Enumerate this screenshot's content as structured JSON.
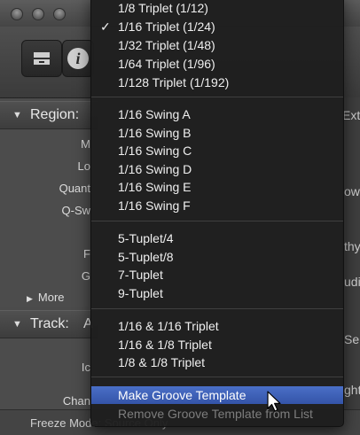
{
  "background": {
    "region_header": "Region:",
    "region_rows": [
      "M",
      "Lo",
      "Quant",
      "Q-Sw",
      "",
      "F",
      "G"
    ],
    "more_label": "More",
    "track_header": "Track:",
    "track_header_suffix": "A",
    "track_rows": [
      "Ic",
      "",
      "Chan"
    ],
    "bottom_text": "Freeze Mode:  Source Only",
    "right_fragments": [
      "Ext",
      "ow",
      "thy",
      "udi",
      "Sele",
      "ght"
    ]
  },
  "menu": {
    "groups": [
      {
        "items": [
          {
            "label": "1/8 Triplet (1/12)",
            "checked": false
          },
          {
            "label": "1/16 Triplet (1/24)",
            "checked": true
          },
          {
            "label": "1/32 Triplet (1/48)",
            "checked": false
          },
          {
            "label": "1/64 Triplet (1/96)",
            "checked": false
          },
          {
            "label": "1/128 Triplet (1/192)",
            "checked": false
          }
        ]
      },
      {
        "items": [
          {
            "label": "1/16 Swing A"
          },
          {
            "label": "1/16 Swing B"
          },
          {
            "label": "1/16 Swing C"
          },
          {
            "label": "1/16 Swing D"
          },
          {
            "label": "1/16 Swing E"
          },
          {
            "label": "1/16 Swing F"
          }
        ]
      },
      {
        "items": [
          {
            "label": "5-Tuplet/4"
          },
          {
            "label": "5-Tuplet/8"
          },
          {
            "label": "7-Tuplet"
          },
          {
            "label": "9-Tuplet"
          }
        ]
      },
      {
        "items": [
          {
            "label": "1/16 & 1/16 Triplet"
          },
          {
            "label": "1/16 & 1/8 Triplet"
          },
          {
            "label": "1/8 & 1/8 Triplet"
          }
        ]
      },
      {
        "items": [
          {
            "label": "Make Groove Template",
            "state": "highlighted"
          },
          {
            "label": "Remove Groove Template from List",
            "state": "disabled"
          }
        ]
      }
    ],
    "check_glyph": "✓"
  },
  "colors": {
    "highlight": "#3d5fb8",
    "menu_bg": "#1e1e1e",
    "disabled_text": "#7d7d7d"
  }
}
